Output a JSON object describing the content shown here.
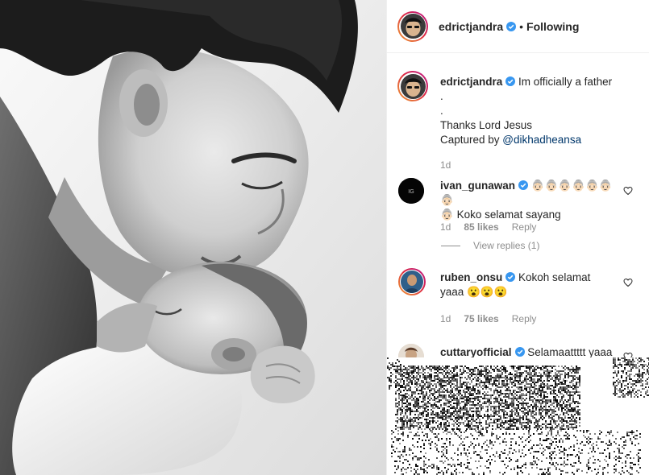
{
  "post": {
    "author": "edrictjandra",
    "follow_state": "Following",
    "separator": "•"
  },
  "caption": {
    "username": "edrictjandra",
    "text_line1": "Im officially a father",
    "text_line2": ".",
    "text_line3": ".",
    "text_line4": "Thanks Lord Jesus",
    "text_line5_prefix": "Captured by ",
    "mention": "@dikhadheansa",
    "time": "1d"
  },
  "comments": [
    {
      "username": "ivan_gunawan",
      "text_emoji": "👵🏻👵🏻👵🏻👵🏻👵🏻👵🏻👵🏻",
      "text_line2_emoji": "👵🏻",
      "text": " Koko selamat sayang",
      "time": "1d",
      "likes": "85 likes",
      "reply": "Reply",
      "view_replies": "View replies (1)"
    },
    {
      "username": "ruben_onsu",
      "text_line1": "Kokoh selamat",
      "text_line2": "yaaa ",
      "text_emoji": "😮😮😮",
      "time": "1d",
      "likes": "75 likes",
      "reply": "Reply"
    },
    {
      "username": "cuttaryofficial",
      "text": "Selamaattttt yaaa"
    }
  ],
  "icons": {
    "verified": "verified-badge-icon",
    "like": "heart-outline-icon"
  },
  "colors": {
    "verified_blue": "#3897f0",
    "text_primary": "#262626",
    "text_secondary": "#8e8e8e",
    "mention": "#00376b",
    "border": "#efefef"
  }
}
